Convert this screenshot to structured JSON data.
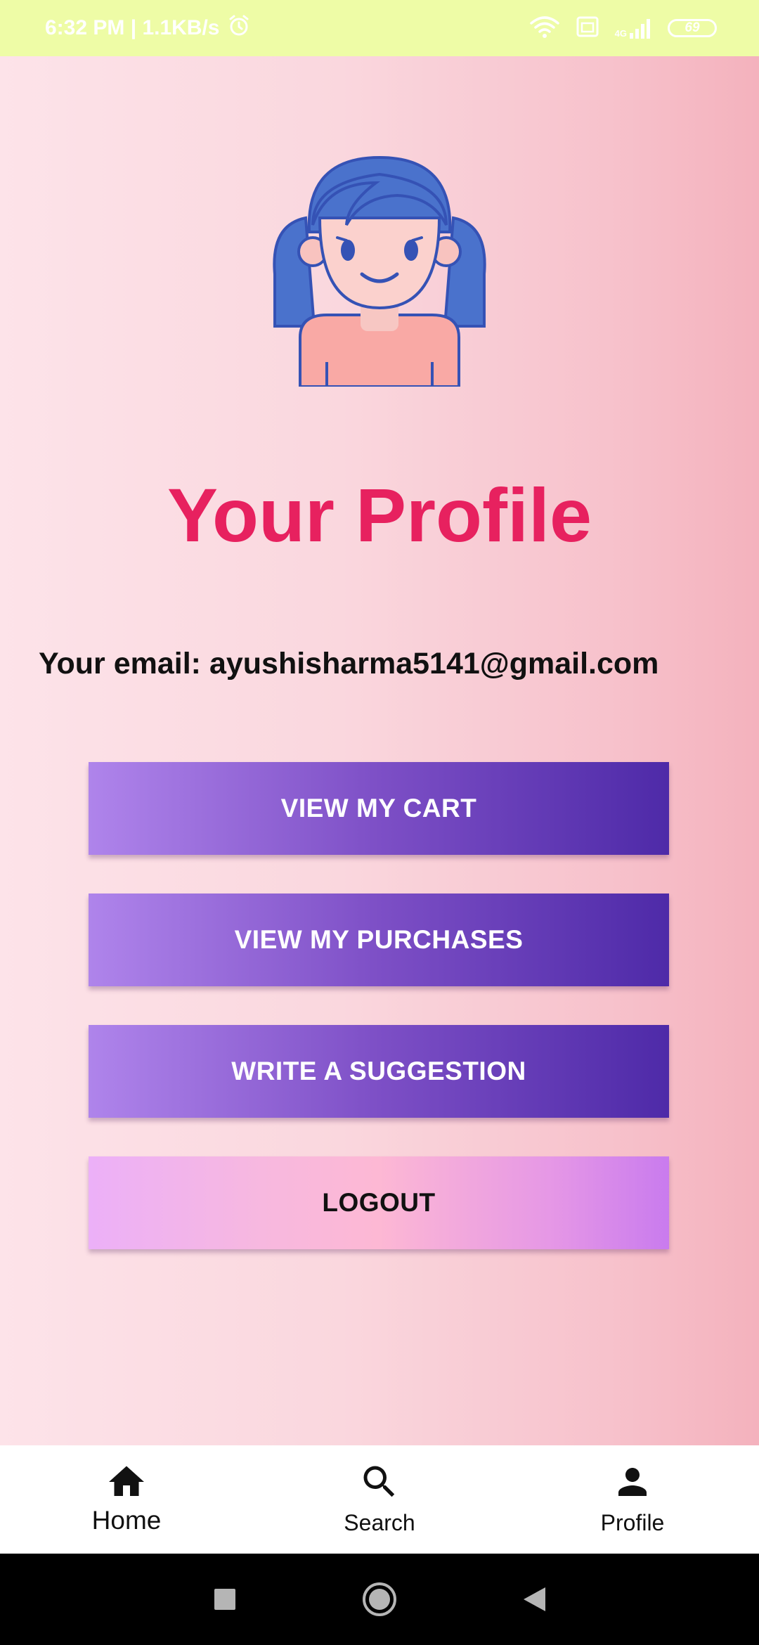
{
  "status_bar": {
    "time_text": "6:32 PM | 1.1KB/s",
    "network_label": "4G",
    "battery_level": "69"
  },
  "profile": {
    "title": "Your Profile",
    "email_label": "Your email:",
    "email_value": "ayushisharma5141@gmail.com"
  },
  "buttons": {
    "view_cart": "VIEW MY CART",
    "view_purchases": "VIEW MY PURCHASES",
    "write_suggestion": "WRITE A SUGGESTION",
    "logout": "LOGOUT"
  },
  "bottom_nav": {
    "items": [
      {
        "label": "Home",
        "icon": "home-icon",
        "active": true
      },
      {
        "label": "Search",
        "icon": "search-icon",
        "active": false
      },
      {
        "label": "Profile",
        "icon": "person-icon",
        "active": false
      }
    ]
  },
  "colors": {
    "title": "#e7215f",
    "status_bar_bg": "#eefca6",
    "button_purple_start": "#af84eb",
    "button_purple_end": "#4e2aa8",
    "logout_pink": "#fdb8d4",
    "avatar_hair": "#4a72cc"
  }
}
